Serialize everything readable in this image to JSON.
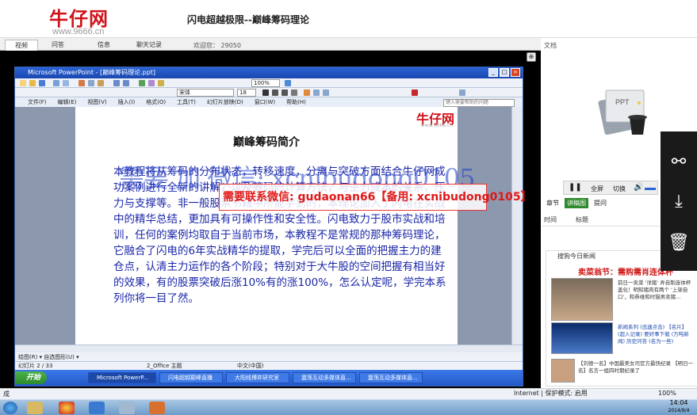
{
  "header": {
    "logo_main": "牛仔网",
    "logo_url": "www.9666.cn",
    "title": "闪电超越极限--巅峰筹码理论"
  },
  "tabs": [
    {
      "label": "视频",
      "active": true
    },
    {
      "label": "问答",
      "active": false
    },
    {
      "label": "信息",
      "active": false
    },
    {
      "label": "聊天记录",
      "active": false
    }
  ],
  "visitors": "欢迎您：  29050",
  "right_panel": {
    "docs_label": "文档",
    "ppt_icon_label": "PPT",
    "ctrl": {
      "fullscreen": "全屏",
      "switch": "切换"
    },
    "subtabs": [
      "章节",
      "讲稿图",
      "提问"
    ],
    "columns": [
      "时间",
      "标题"
    ]
  },
  "ppt": {
    "window_title": "Microsoft PowerPoint - [巅峰筹码理论.ppt]",
    "font": "宋体",
    "size": "18",
    "zoom": "100%",
    "help_placeholder": "键入需要帮助的问题",
    "menu": [
      "文件(F)",
      "编辑(E)",
      "视图(V)",
      "插入(I)",
      "格式(O)",
      "工具(T)",
      "幻灯片放映(D)",
      "窗口(W)",
      "帮助(H)"
    ],
    "draw_label": "绘图(R) ▾  自选图形(U) ▾",
    "status": {
      "slide": "幻灯片 2 / 33",
      "design": "2_Office 主题",
      "lang": "中文(中国)"
    },
    "slide": {
      "logo": "牛仔网",
      "logo_url": "www.9666.cn",
      "title": "巅峰筹码简介",
      "body": "本教程将从筹码的分布状态，转移速度，分离与突破方面结合牛仔网成功案例进行全新的讲解，以及筹码的计算方法，与主力成本的关系，压力与支撑等。非一般股票书籍中所能学到的，本理论加入了闪电在实战中的精华总结，更加具有可操作性和安全性。闪电致力于股市实战和培训，任何的案例均取自于当前市场，本教程不是常规的那种筹码理论，它融合了闪电的6年实战精华的提取，学完后可以全面的把握主力的建仓点，认清主力运作的各个阶段；特别对于大牛股的空间把握有相当好的效果，有的股票突破后涨10%有的涨100%，怎么认定呢，学完本系列你将一目了然。"
    },
    "taskbar": {
      "start": "开始",
      "items": [
        "Microsoft PowerP...",
        "闪电超越巅峰直播",
        "大阳线博弈研究室",
        "震荡互动多媒体直...",
        "震荡互动多媒体直..."
      ]
    }
  },
  "watermarks": {
    "blue": "需要 加 微信: xcnibudong0105",
    "red": "需要联系微信: gudaonan66【备用: xcnibudong0105】"
  },
  "ad_panel": {
    "head": "搜狗今日新闻",
    "title": "卖菜翁节：需购需肖连体杯",
    "items": [
      "前日一卖菜 '洋猪' 弄自制连体杯盖化！明知猪肉有两个 '上架自口'，和恭维和时猫男卖猪…",
      "新闻系列 (迅速点击) 【名片】(超入记录) 要好事下载 (万吨新闻) 历史问答 (名为一些)",
      "【刘德一名】中国最美女司官方最快纪录 【明日一名】名言一组四时期纪录了"
    ]
  },
  "share_panel": {
    "share": "share",
    "download": "download",
    "delete": "delete"
  },
  "ie_status": {
    "left": "成",
    "zone": "Internet | 保护模式: 启用",
    "zoom": "100%"
  },
  "clock": {
    "time": "14:04",
    "date": "2014/9/4"
  },
  "colors": {
    "brand_red": "#d0121b",
    "slide_text": "#1a26a8",
    "tab_green": "#2f8a2f"
  }
}
